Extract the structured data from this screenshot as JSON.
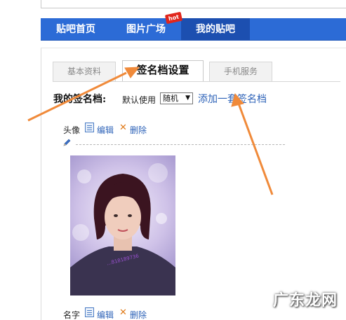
{
  "nav": {
    "items": [
      "贴吧首页",
      "图片广场",
      "我的贴吧"
    ],
    "active": "我的贴吧",
    "badge": "hot",
    "color": "#2c6bd6"
  },
  "tabs": [
    "基本资料",
    "签名档设置",
    "手机服务"
  ],
  "active_tab": "签名档设置",
  "signature": {
    "title": "我的签名档:",
    "default_label": "默认使用",
    "select_value": "随机",
    "add_link": "添加一套签名档"
  },
  "rows": {
    "avatar_label": "头像",
    "name_label": "名字",
    "edit": "编辑",
    "delete": "删除"
  },
  "photo": {
    "watermark": "...818189736"
  },
  "brand_watermark": "广东龙网",
  "annotation_color": "#f08a3a",
  "icons": [
    "edit-icon",
    "delete-icon",
    "pencil-icon",
    "dropdown-arrow-icon"
  ]
}
